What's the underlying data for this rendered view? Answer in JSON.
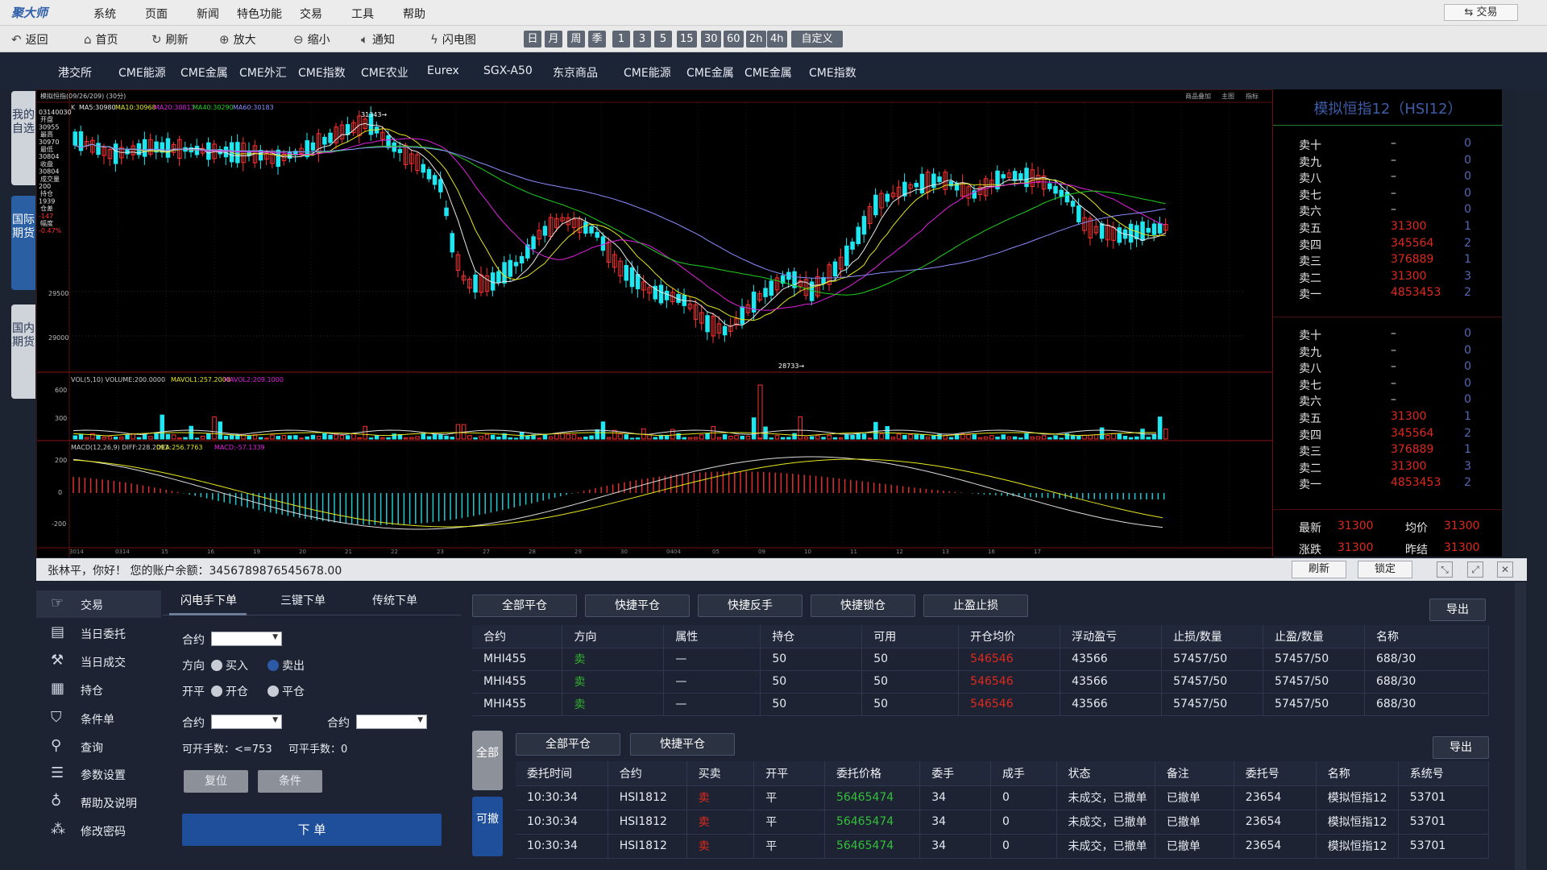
{
  "menu": {
    "logo": "聚大师",
    "items": [
      "系统",
      "页面",
      "新闻",
      "特色功能",
      "交易",
      "工具",
      "帮助"
    ],
    "trade": "⇆ 交易"
  },
  "toolbar": {
    "items": [
      {
        "icon": "back-icon",
        "label": "返回"
      },
      {
        "icon": "home-icon",
        "label": "首页"
      },
      {
        "icon": "refresh-icon",
        "label": "刷新"
      },
      {
        "icon": "zoom-in-icon",
        "label": "放大"
      },
      {
        "icon": "zoom-out-icon",
        "label": "缩小"
      },
      {
        "icon": "speaker-icon",
        "label": "通知"
      },
      {
        "icon": "lightning-icon",
        "label": "闪电图"
      }
    ],
    "periods": [
      "日",
      "月",
      "周",
      "季",
      "1",
      "3",
      "5",
      "15",
      "30",
      "60",
      "2h",
      "4h",
      "自定义"
    ]
  },
  "exchanges": [
    "港交所",
    "CME能源",
    "CME金属",
    "CME外汇",
    "CME指数",
    "CME农业",
    "Eurex",
    "SGX-A50",
    "东京商品",
    "CME能源",
    "CME金属",
    "CME金属",
    "CME指数"
  ],
  "sidetabs": [
    {
      "label": "我的自选",
      "active": false
    },
    {
      "label": "国际期货",
      "active": true
    },
    {
      "label": "国内期货",
      "active": false
    }
  ],
  "chart": {
    "title": "模拟恒指(09/26/209) (30分)",
    "ma_legend": {
      "k": "K",
      "ma5": "MA5:30980",
      "ma10": "MA10:30968",
      "ma20": "MA20:30813",
      "ma40": "MA40:30290",
      "ma60": "MA60:30183"
    },
    "vol_legend": {
      "a": "VOL(5,10) VOLUME:200.0000",
      "b": "MAVOL1:257.2000",
      "c": "MAVOL2:209.1000"
    },
    "macd_legend": {
      "a": "MACD(12,26,9) DIFF:228.2093",
      "b": "DEA:256.7763",
      "c": "MACD:-57.1339"
    },
    "high_label": "31343",
    "low_label": "28733",
    "price_ticks": [
      "29500",
      "29000"
    ],
    "vol_ticks": [
      "600",
      "300"
    ],
    "macd_ticks": [
      "200",
      "0",
      "-200"
    ],
    "info_labels": [
      "03140030",
      "开盘",
      "30955",
      "最高",
      "30970",
      "最低",
      "30804",
      "收盘",
      "30804",
      "成交量",
      "200",
      "持仓",
      "1939",
      "仓差",
      "-147",
      "幅度",
      "-0.47%"
    ],
    "top_buttons": [
      "商品叠加",
      "主图",
      "指标"
    ],
    "date_labels": [
      "3014",
      "0314",
      "15",
      "16",
      "19",
      "20",
      "21",
      "22",
      "23",
      "27",
      "28",
      "29",
      "30",
      "0404",
      "05",
      "09",
      "10",
      "11",
      "12",
      "13",
      "16",
      "17"
    ],
    "colors": {
      "up": "#ff3030",
      "down": "#1fe6f0",
      "ma5": "#e8e8e8",
      "ma10": "#e6e61e",
      "ma20": "#e020e0",
      "ma40": "#20d020",
      "ma60": "#8c8cff"
    }
  },
  "orderbook": {
    "title": "模拟恒指12（HSI12）",
    "group1": [
      {
        "label": "卖十",
        "price": "–",
        "qty": "0"
      },
      {
        "label": "卖九",
        "price": "–",
        "qty": "0"
      },
      {
        "label": "卖八",
        "price": "–",
        "qty": "0"
      },
      {
        "label": "卖七",
        "price": "–",
        "qty": "0"
      },
      {
        "label": "卖六",
        "price": "–",
        "qty": "0"
      },
      {
        "label": "卖五",
        "price": "31300",
        "qty": "1"
      },
      {
        "label": "卖四",
        "price": "345564",
        "qty": "2"
      },
      {
        "label": "卖三",
        "price": "376889",
        "qty": "1"
      },
      {
        "label": "卖二",
        "price": "31300",
        "qty": "3"
      },
      {
        "label": "卖一",
        "price": "4853453",
        "qty": "2"
      }
    ],
    "group2": [
      {
        "label": "卖十",
        "price": "–",
        "qty": "0"
      },
      {
        "label": "卖九",
        "price": "–",
        "qty": "0"
      },
      {
        "label": "卖八",
        "price": "–",
        "qty": "0"
      },
      {
        "label": "卖七",
        "price": "–",
        "qty": "0"
      },
      {
        "label": "卖六",
        "price": "–",
        "qty": "0"
      },
      {
        "label": "卖五",
        "price": "31300",
        "qty": "1"
      },
      {
        "label": "卖四",
        "price": "345564",
        "qty": "2"
      },
      {
        "label": "卖三",
        "price": "376889",
        "qty": "1"
      },
      {
        "label": "卖二",
        "price": "31300",
        "qty": "3"
      },
      {
        "label": "卖一",
        "price": "4853453",
        "qty": "2"
      }
    ],
    "stats": {
      "latest_label": "最新",
      "latest": "31300",
      "avg_label": "均价",
      "avg": "31300",
      "change_label": "涨跌",
      "change": "31300",
      "prev_label": "昨结",
      "prev": "31300"
    }
  },
  "account": {
    "message": "张林平，你好！ 您的账户余额：3456789876545678.00",
    "refresh": "刷新",
    "lock": "锁定"
  },
  "leftnav": [
    {
      "icon": "trade-icon",
      "label": "交易"
    },
    {
      "icon": "order-icon",
      "label": "当日委托"
    },
    {
      "icon": "deal-icon",
      "label": "当日成交"
    },
    {
      "icon": "position-icon",
      "label": "持仓"
    },
    {
      "icon": "filter-icon",
      "label": "条件单"
    },
    {
      "icon": "search-icon",
      "label": "查询"
    },
    {
      "icon": "settings-icon",
      "label": "参数设置"
    },
    {
      "icon": "bulb-icon",
      "label": "帮助及说明"
    },
    {
      "icon": "password-icon",
      "label": "修改密码"
    }
  ],
  "orderform": {
    "tabs": [
      "闪电手下单",
      "三键下单",
      "传统下单"
    ],
    "contract": "合约",
    "direction": "方向",
    "buy": "买入",
    "sell": "卖出",
    "openclose": "开平",
    "open": "开仓",
    "close": "平仓",
    "contract2": "合约",
    "contract3": "合约",
    "openable": "可开手数：<=753",
    "closable": "可平手数：0",
    "reset": "复位",
    "condition": "条件",
    "submit": "下 单"
  },
  "positions": {
    "buttons": [
      "全部平仓",
      "快捷平仓",
      "快捷反手",
      "快捷锁仓",
      "止盈止损"
    ],
    "export": "导出",
    "headers": [
      "合约",
      "方向",
      "属性",
      "持仓",
      "可用",
      "开仓均价",
      "浮动盈亏",
      "止损/数量",
      "止盈/数量",
      "名称"
    ],
    "rows": [
      [
        "MHI455",
        "卖",
        "—",
        "50",
        "50",
        "546546",
        "43566",
        "57457/50",
        "57457/50",
        "688/30"
      ],
      [
        "MHI455",
        "卖",
        "—",
        "50",
        "50",
        "546546",
        "43566",
        "57457/50",
        "57457/50",
        "688/30"
      ],
      [
        "MHI455",
        "卖",
        "—",
        "50",
        "50",
        "546546",
        "43566",
        "57457/50",
        "57457/50",
        "688/30"
      ]
    ]
  },
  "orders": {
    "vtab_all": "全部",
    "vtab_cancel": "可撤",
    "buttons": [
      "全部平仓",
      "快捷平仓"
    ],
    "export": "导出",
    "headers": [
      "委托时间",
      "合约",
      "买卖",
      "开平",
      "委托价格",
      "委手",
      "成手",
      "状态",
      "备注",
      "委托号",
      "名称",
      "系统号"
    ],
    "rows": [
      [
        "10:30:34",
        "HSI1812",
        "卖",
        "平",
        "56465474",
        "34",
        "0",
        "未成交，已撤单",
        "已撤单",
        "23654",
        "模拟恒指12",
        "53701"
      ],
      [
        "10:30:34",
        "HSI1812",
        "卖",
        "平",
        "56465474",
        "34",
        "0",
        "未成交，已撤单",
        "已撤单",
        "23654",
        "模拟恒指12",
        "53701"
      ],
      [
        "10:30:34",
        "HSI1812",
        "卖",
        "平",
        "56465474",
        "34",
        "0",
        "未成交，已撤单",
        "已撤单",
        "23654",
        "模拟恒指12",
        "53701"
      ]
    ]
  }
}
